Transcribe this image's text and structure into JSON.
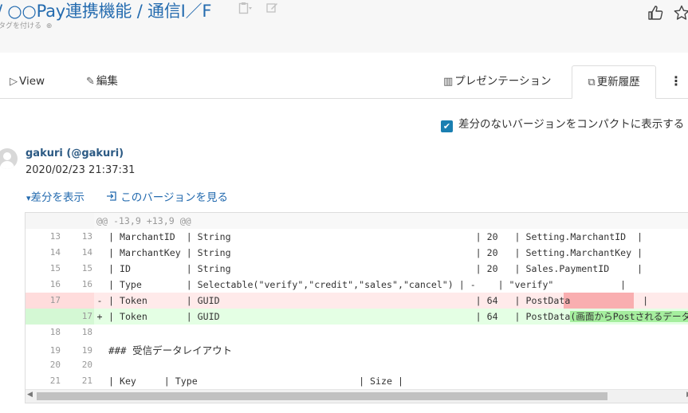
{
  "header": {
    "title": "/ ○○Pay連携機能 / 通信I／F",
    "tag_label": "タグを付ける",
    "tag_add_icon": "⊕",
    "copy_icon": "clipboard-icon",
    "edit_icon": "pencil-square-icon"
  },
  "tabs": {
    "view": "View",
    "edit": "編集",
    "presentation": "プレゼンテーション",
    "history": "更新履歴"
  },
  "options": {
    "compact_label": "差分のないバージョンをコンパクトに表示する",
    "compact_checked": true
  },
  "revision": {
    "author": "gakuri (@gakuri)",
    "timestamp": "2020/02/23 21:37:31",
    "show_diff": "差分を表示",
    "view_version": "このバージョンを見る"
  },
  "diff": {
    "hunk": "@@ -13,9 +13,9 @@",
    "rows": [
      {
        "old": "13",
        "new": "13",
        "mark": "",
        "code": "| MarchantID  | String                                            | 20   | Setting.MarchantID  |"
      },
      {
        "old": "14",
        "new": "14",
        "mark": "",
        "code": "| MarchantKey | String                                            | 20   | Setting.MarchantKey |"
      },
      {
        "old": "15",
        "new": "15",
        "mark": "",
        "code": "| ID          | String                                            | 20   | Sales.PaymentID     |"
      },
      {
        "old": "16",
        "new": "16",
        "mark": "",
        "code": "| Type        | Selectable(\"verify\",\"credit\",\"sales\",\"cancel\") | -    | \"verify\"            |"
      },
      {
        "old": "17",
        "new": "",
        "mark": "-",
        "code": "| Token       | GUID                                              | 64   | PostData             |"
      },
      {
        "old": "",
        "new": "17",
        "mark": "+",
        "code": "| Token       | GUID                                              | 64   | PostData",
        "added": "(画面からPostされるデータ"
      },
      {
        "old": "18",
        "new": "18",
        "mark": "",
        "code": ""
      },
      {
        "old": "19",
        "new": "19",
        "mark": "",
        "code": "### 受信データレイアウト"
      },
      {
        "old": "20",
        "new": "20",
        "mark": "",
        "code": ""
      },
      {
        "old": "21",
        "new": "21",
        "mark": "",
        "code": "| Key     | Type                             | Size |"
      }
    ]
  }
}
